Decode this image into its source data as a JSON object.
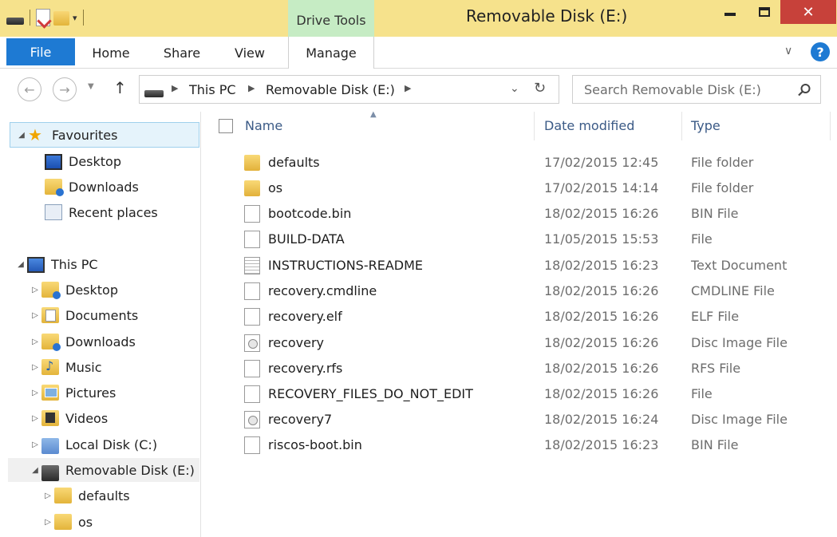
{
  "window": {
    "title": "Removable Disk (E:)",
    "context_tab_group": "Drive Tools",
    "close_glyph": "✕"
  },
  "ribbon": {
    "tabs": [
      {
        "label": "File"
      },
      {
        "label": "Home"
      },
      {
        "label": "Share"
      },
      {
        "label": "View"
      },
      {
        "label": "Manage"
      }
    ],
    "help_glyph": "?"
  },
  "address_bar": {
    "breadcrumbs": [
      "This PC",
      "Removable Disk (E:)"
    ],
    "search_placeholder": "Search Removable Disk (E:)"
  },
  "nav_pane": {
    "favourites": {
      "label": "Favourites",
      "items": [
        {
          "label": "Desktop",
          "icon": "desktop-icon"
        },
        {
          "label": "Downloads",
          "icon": "downloads-folder-icon"
        },
        {
          "label": "Recent places",
          "icon": "recent-places-icon"
        }
      ]
    },
    "this_pc": {
      "label": "This PC",
      "items": [
        {
          "label": "Desktop",
          "icon": "desktop-folder-icon"
        },
        {
          "label": "Documents",
          "icon": "documents-folder-icon"
        },
        {
          "label": "Downloads",
          "icon": "downloads-folder-icon"
        },
        {
          "label": "Music",
          "icon": "music-folder-icon"
        },
        {
          "label": "Pictures",
          "icon": "pictures-folder-icon"
        },
        {
          "label": "Videos",
          "icon": "videos-folder-icon"
        },
        {
          "label": "Local Disk (C:)",
          "icon": "local-disk-icon"
        },
        {
          "label": "Removable Disk (E:)",
          "icon": "removable-disk-icon"
        },
        {
          "label": "defaults",
          "icon": "folder-icon"
        },
        {
          "label": "os",
          "icon": "folder-icon"
        }
      ]
    }
  },
  "file_list": {
    "columns": {
      "name": "Name",
      "date": "Date modified",
      "type": "Type"
    },
    "rows": [
      {
        "name": "defaults",
        "date": "17/02/2015 12:45",
        "type": "File folder",
        "icon": "folder-icon"
      },
      {
        "name": "os",
        "date": "17/02/2015 14:14",
        "type": "File folder",
        "icon": "folder-icon"
      },
      {
        "name": "bootcode.bin",
        "date": "18/02/2015 16:26",
        "type": "BIN File",
        "icon": "file-icon"
      },
      {
        "name": "BUILD-DATA",
        "date": "11/05/2015 15:53",
        "type": "File",
        "icon": "file-icon"
      },
      {
        "name": "INSTRUCTIONS-README",
        "date": "18/02/2015 16:23",
        "type": "Text Document",
        "icon": "text-document-icon"
      },
      {
        "name": "recovery.cmdline",
        "date": "18/02/2015 16:26",
        "type": "CMDLINE File",
        "icon": "file-icon"
      },
      {
        "name": "recovery.elf",
        "date": "18/02/2015 16:26",
        "type": "ELF File",
        "icon": "file-icon"
      },
      {
        "name": "recovery",
        "date": "18/02/2015 16:26",
        "type": "Disc Image File",
        "icon": "disc-image-icon"
      },
      {
        "name": "recovery.rfs",
        "date": "18/02/2015 16:26",
        "type": "RFS File",
        "icon": "file-icon"
      },
      {
        "name": "RECOVERY_FILES_DO_NOT_EDIT",
        "date": "18/02/2015 16:26",
        "type": "File",
        "icon": "file-icon"
      },
      {
        "name": "recovery7",
        "date": "18/02/2015 16:24",
        "type": "Disc Image File",
        "icon": "disc-image-icon"
      },
      {
        "name": "riscos-boot.bin",
        "date": "18/02/2015 16:23",
        "type": "BIN File",
        "icon": "file-icon"
      }
    ]
  },
  "colors": {
    "title_bar": "#f6e28c",
    "context_tab": "#c6ecc4",
    "file_tab": "#1e7ad3",
    "close_button": "#c7413a",
    "column_header_text": "#3b5a86"
  }
}
